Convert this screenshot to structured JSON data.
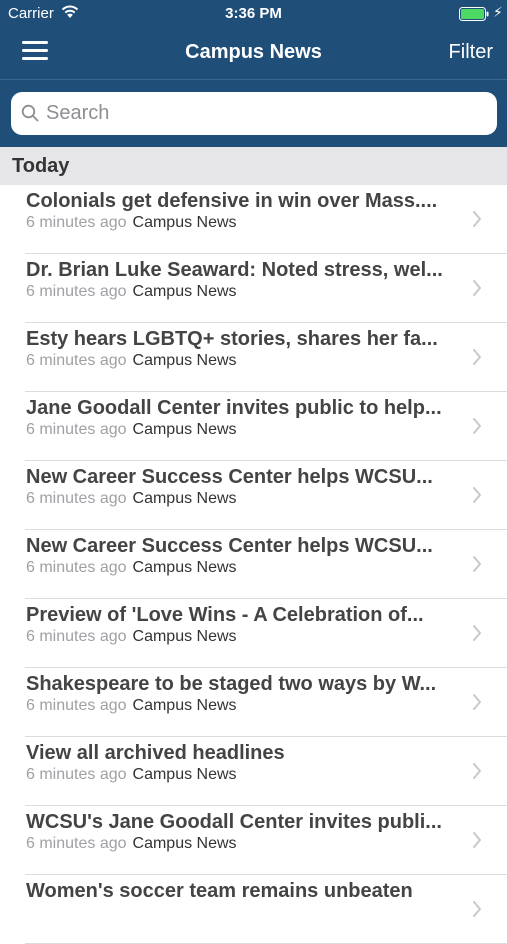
{
  "status_bar": {
    "carrier": "Carrier",
    "time": "3:36 PM"
  },
  "nav": {
    "title": "Campus News",
    "filter_label": "Filter"
  },
  "search": {
    "placeholder": "Search",
    "value": ""
  },
  "section": {
    "title": "Today"
  },
  "colors": {
    "header_bg": "#1f4e79",
    "battery_green": "#4cd964",
    "section_bg": "#e6e6e9"
  },
  "icons": [
    "wifi-icon",
    "battery-icon",
    "charging-bolt-icon",
    "hamburger-menu-icon",
    "search-icon",
    "chevron-right-icon"
  ],
  "articles": [
    {
      "title": "Colonials get defensive in win over Mass....",
      "time": "6 minutes ago",
      "source": "Campus News"
    },
    {
      "title": "Dr. Brian Luke Seaward: Noted stress, wel...",
      "time": "6 minutes ago",
      "source": "Campus News"
    },
    {
      "title": "Esty hears LGBTQ+ stories, shares her fa...",
      "time": "6 minutes ago",
      "source": "Campus News"
    },
    {
      "title": "Jane Goodall Center invites public to help...",
      "time": "6 minutes ago",
      "source": "Campus News"
    },
    {
      "title": "New Career Success Center helps WCSU...",
      "time": "6 minutes ago",
      "source": "Campus News"
    },
    {
      "title": "New Career Success Center helps WCSU...",
      "time": "6 minutes ago",
      "source": "Campus News"
    },
    {
      "title": "Preview of 'Love Wins - A Celebration of...",
      "time": "6 minutes ago",
      "source": "Campus News"
    },
    {
      "title": "Shakespeare to be staged two ways by W...",
      "time": "6 minutes ago",
      "source": "Campus News"
    },
    {
      "title": "View all archived headlines",
      "time": "6 minutes ago",
      "source": "Campus News"
    },
    {
      "title": "WCSU's Jane Goodall Center invites publi...",
      "time": "6 minutes ago",
      "source": "Campus News"
    },
    {
      "title": "Women's soccer team remains unbeaten",
      "time": "",
      "source": ""
    }
  ]
}
